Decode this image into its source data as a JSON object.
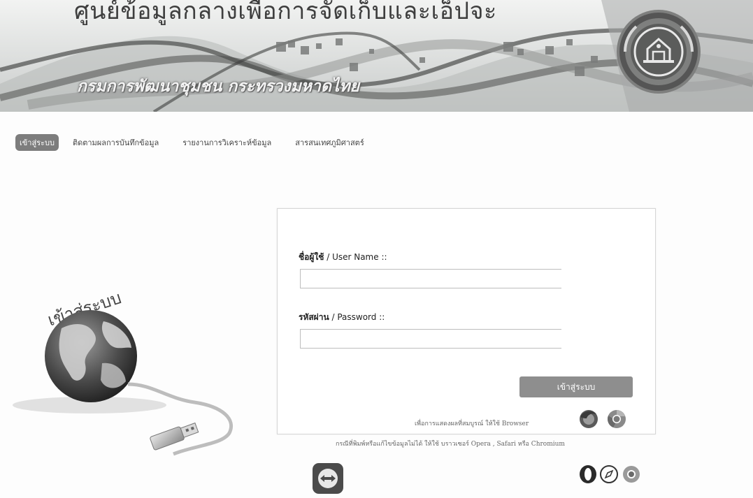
{
  "header": {
    "title": "ศูนย์ข้อมูลกลางเพื่อการจัดเก็บและเอ็ปจะ",
    "subtitle": "กรมการพัฒนาชุมชน กระทรวงมหาดไทย"
  },
  "nav": {
    "items": [
      {
        "label": "เข้าสู่ระบบ",
        "active": true
      },
      {
        "label": "ติดตามผลการบันทึกข้อมูล",
        "active": false
      },
      {
        "label": "รายงานการวิเคราะห์ข้อมูล",
        "active": false
      },
      {
        "label": "สารสนเทศภูมิศาสตร์",
        "active": false
      }
    ]
  },
  "graphic": {
    "caption": "เข้าสู่ระบบ"
  },
  "login": {
    "username_label_th": "ชื่อผู้ใช้",
    "username_label_en": " / User Name ::",
    "username_value": "",
    "password_label_th": "รหัสผ่าน",
    "password_label_en": " / Password ::",
    "password_value": "",
    "submit_label": "เข้าสู่ระบบ",
    "browser_note": "เพื่อการแสดงผลที่สมบูรณ์ ให้ใช้ Browser",
    "browser_icons": [
      "firefox-icon",
      "chrome-icon"
    ]
  },
  "footer": {
    "note": "กรณีที่พิมพ์หรือแก้ไขข้อมูลไม่ได้ ให้ใช้ บราวเซอร์ Opera , Safari หรือ Chromium",
    "browser_icons": [
      "opera-icon",
      "safari-icon",
      "chromium-icon"
    ],
    "support_icon": "teamviewer-icon"
  },
  "colors": {
    "nav_active_bg": "#7d7d7d",
    "button_bg": "#8e8e8e",
    "panel_border": "#d6d6d6"
  }
}
